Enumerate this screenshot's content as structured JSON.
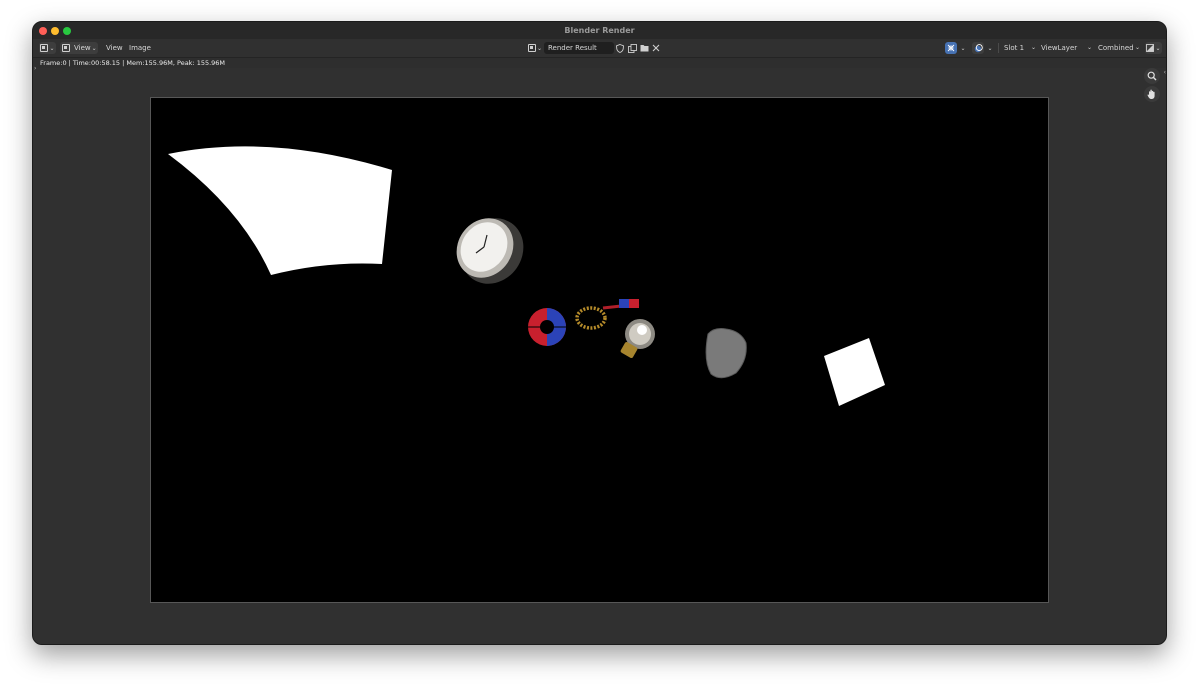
{
  "window": {
    "title": "Blender Render"
  },
  "header": {
    "editor_type_icon": "image-editor-icon",
    "menus": [
      "View",
      "View",
      "Image"
    ],
    "image_name": "Render Result",
    "slot": "Slot 1",
    "view_layer": "ViewLayer",
    "render_pass": "Combined"
  },
  "status": {
    "text": "Frame:0 | Time:00:58.15 | Mem:155.96M, Peak: 155.96M"
  },
  "render": {
    "objects": [
      "curved-white-plane",
      "wall-clock",
      "magnet",
      "gear-chain",
      "light-bulb",
      "rock",
      "white-square-plane"
    ]
  },
  "colors": {
    "window_bg": "#2e2e2e",
    "render_bg": "#000000",
    "accent_blue": "#4772b3"
  }
}
